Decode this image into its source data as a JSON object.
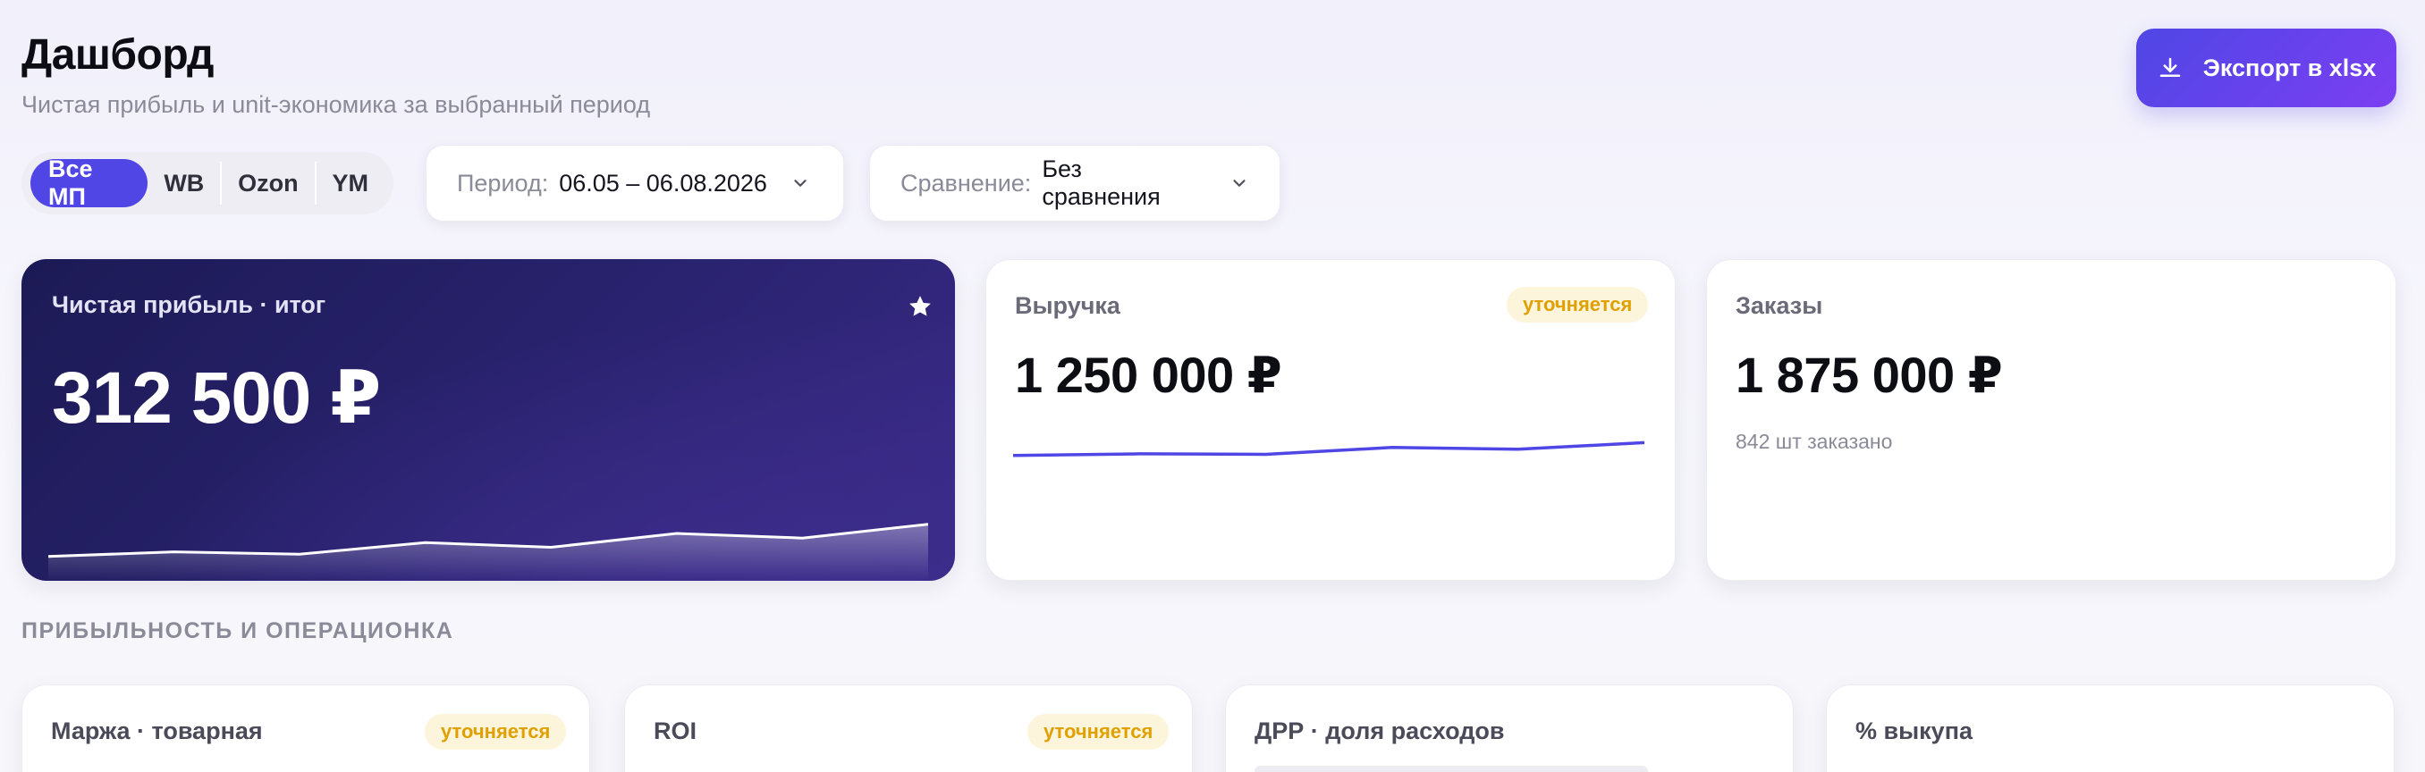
{
  "header": {
    "title": "Дашборд",
    "subtitle": "Чистая прибыль и unit-экономика за выбранный период",
    "export_label": "Экспорт в xlsx"
  },
  "filters": {
    "marketplaces": [
      "Все МП",
      "WB",
      "Ozon",
      "YM"
    ],
    "active_marketplace": "Все МП",
    "period": {
      "label": "Период:",
      "value": "06.05 – 06.08.2026"
    },
    "comparison": {
      "label": "Сравнение:",
      "value": "Без сравнения"
    }
  },
  "kpi": {
    "hero": {
      "label": "Чистая прибыль · итог",
      "value": "312 500 ₽",
      "trend": [
        0.2,
        0.26,
        0.23,
        0.38,
        0.32,
        0.5,
        0.44,
        0.62
      ]
    },
    "revenue": {
      "label": "Выручка",
      "badge": "уточняется",
      "value": "1 250 000 ₽",
      "trend": [
        0.1,
        0.16,
        0.14,
        0.38,
        0.32,
        0.55
      ]
    },
    "orders": {
      "label": "Заказы",
      "value": "1 875 000 ₽",
      "note": "842 шт заказано"
    }
  },
  "section": {
    "title": "ПРИБЫЛЬНОСТЬ И ОПЕРАЦИОНКА",
    "cards": [
      {
        "label": "Маржа · товарная",
        "badge": "уточняется"
      },
      {
        "label": "ROI",
        "badge": "уточняется"
      },
      {
        "label": "ДРР · доля расходов",
        "badge": ""
      },
      {
        "label": "% выкупа",
        "badge": ""
      }
    ]
  },
  "colors": {
    "accent": "#4f46e5",
    "accent_2": "#7b3ff2",
    "hero_bg": "#241f66",
    "badge_bg": "#fdf4dc",
    "badge_text": "#e0a000",
    "sparkline_revenue": "#4f46e5"
  },
  "icons": {
    "export": "download-icon",
    "chevron": "chevron-down-icon",
    "favorite": "star-icon"
  }
}
